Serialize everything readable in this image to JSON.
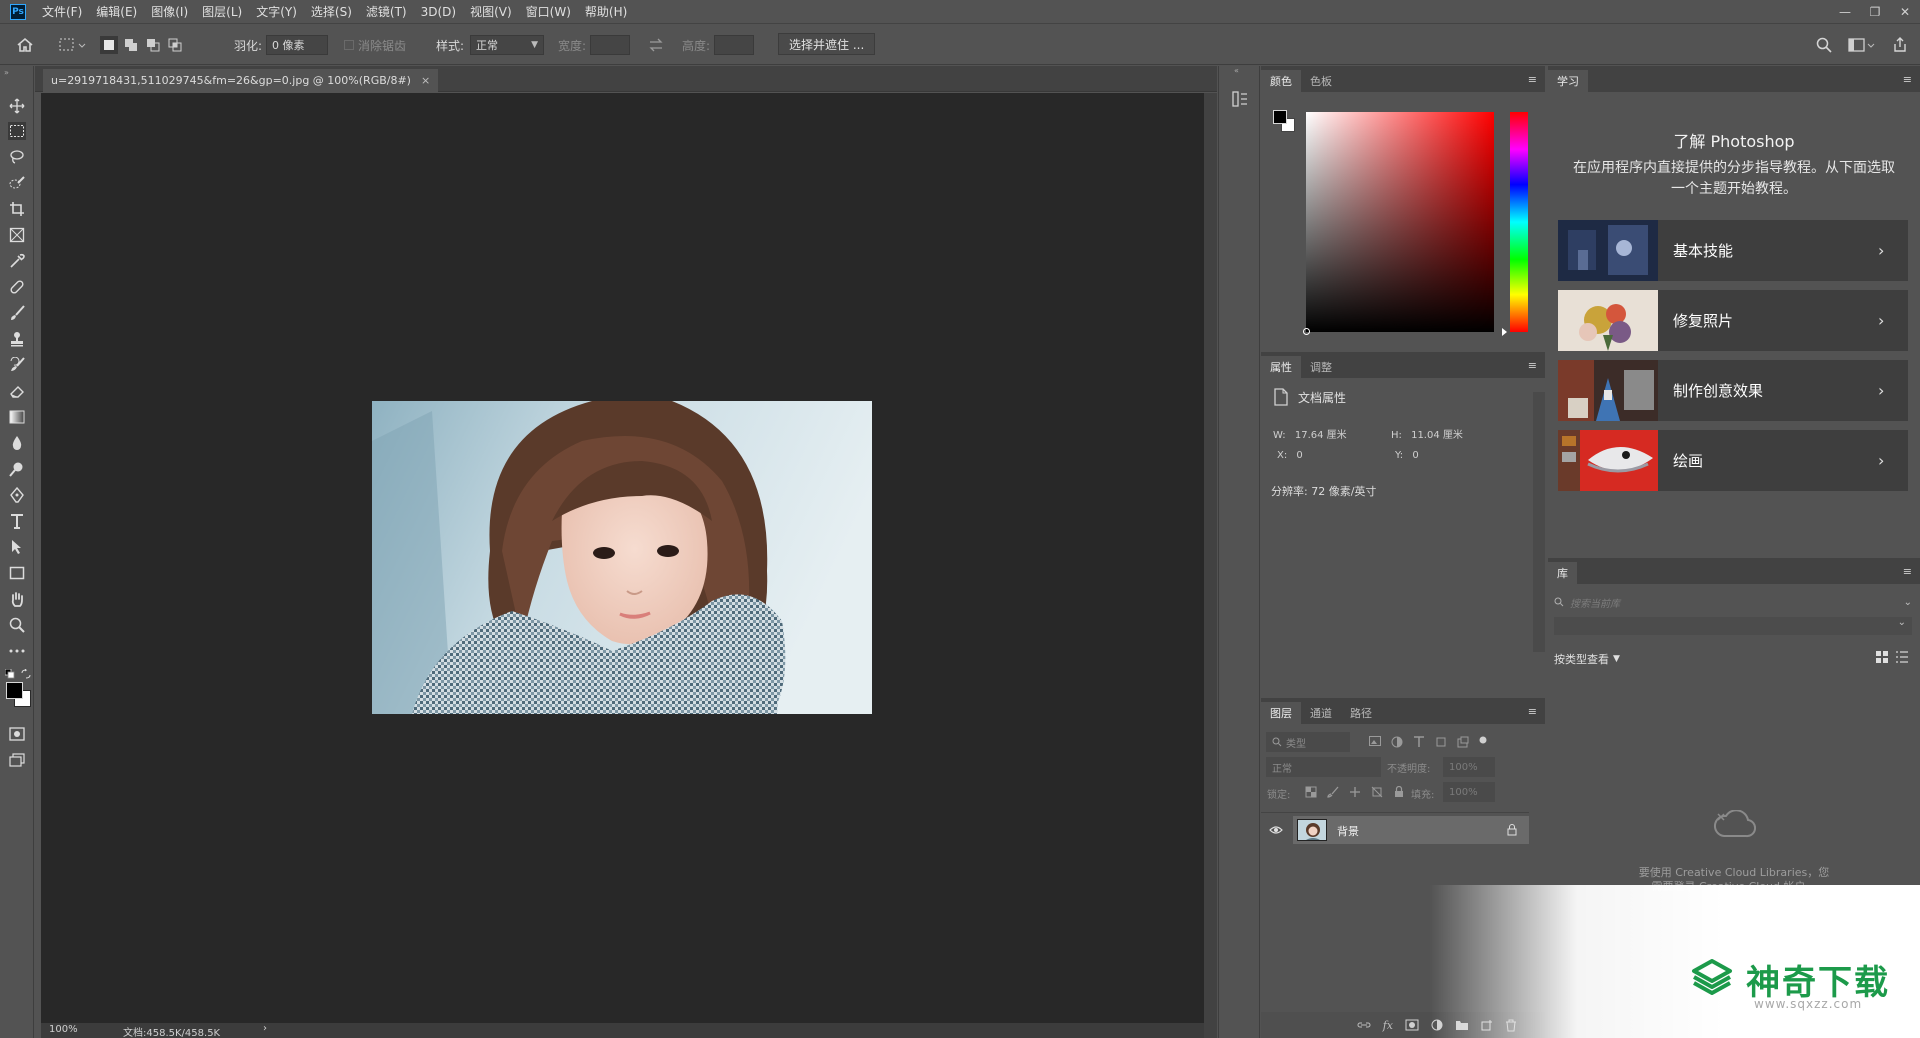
{
  "app": {
    "logo": "Ps"
  },
  "menu": [
    "文件(F)",
    "编辑(E)",
    "图像(I)",
    "图层(L)",
    "文字(Y)",
    "选择(S)",
    "滤镜(T)",
    "3D(D)",
    "视图(V)",
    "窗口(W)",
    "帮助(H)"
  ],
  "window_controls": {
    "minimize": "—",
    "restore": "❐",
    "close": "✕"
  },
  "options": {
    "feather_label": "羽化:",
    "feather_value": "0 像素",
    "antialias_label": "消除锯齿",
    "style_label": "样式:",
    "style_value": "正常",
    "width_label": "宽度:",
    "height_label": "高度:",
    "select_mask_button": "选择并遮住 ..."
  },
  "document": {
    "tab_title": "u=2919718431,511029745&fm=26&gp=0.jpg @ 100%(RGB/8#)",
    "tab_close": "×",
    "zoom": "100%",
    "doc_size": "文档:458.5K/458.5K",
    "status_arrow": "›"
  },
  "color_panel": {
    "tabs": [
      "颜色",
      "色板"
    ],
    "foreground": "#000000",
    "background": "#ffffff",
    "hue_color": "#ff0000"
  },
  "properties_panel": {
    "tabs": [
      "属性",
      "调整"
    ],
    "doc_props_label": "文档属性",
    "w_label": "W:",
    "w_value": "17.64 厘米",
    "h_label": "H:",
    "h_value": "11.04 厘米",
    "x_label": "X:",
    "x_value": "0",
    "y_label": "Y:",
    "y_value": "0",
    "resolution": "分辨率: 72 像素/英寸"
  },
  "layers_panel": {
    "tabs": [
      "图层",
      "通道",
      "路径"
    ],
    "kind_placeholder": "类型",
    "blend_mode": "正常",
    "opacity_label": "不透明度:",
    "opacity_value": "100%",
    "lock_label": "锁定:",
    "fill_label": "填充:",
    "fill_value": "100%",
    "layer_name": "背景"
  },
  "learn_panel": {
    "tab": "学习",
    "title": "了解 Photoshop",
    "description": "在应用程序内直接提供的分步指导教程。从下面选取一个主题开始教程。",
    "cards": [
      {
        "label": "基本技能"
      },
      {
        "label": "修复照片"
      },
      {
        "label": "制作创意效果"
      },
      {
        "label": "绘画"
      }
    ]
  },
  "library_panel": {
    "tab": "库",
    "search_placeholder": "搜索当前库",
    "view_by": "按类型查看",
    "cc_message_line1": "要使用 Creative Cloud Libraries，您",
    "cc_message_line2": "需要登录 Creative Cloud 帐户。"
  },
  "watermark": {
    "brand": "神奇下载",
    "url": "www.sqxzz.com",
    "color": "#1c9a4a"
  }
}
